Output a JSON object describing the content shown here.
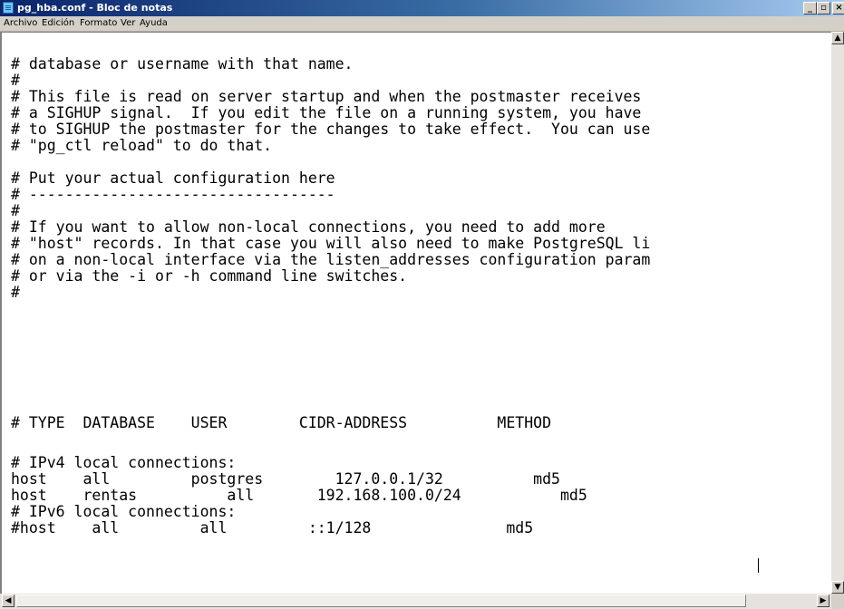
{
  "window": {
    "title": "pg_hba.conf - Bloc de notas",
    "controls": {
      "minimize": "_",
      "maximize": "▫",
      "close": "×"
    }
  },
  "menu": {
    "items": [
      "Archivo",
      "Edición",
      "Formato",
      "Ver",
      "Ayuda"
    ]
  },
  "editor": {
    "lines": [
      "# database or username with that name.",
      "#",
      "# This file is read on server startup and when the postmaster receives",
      "# a SIGHUP signal.  If you edit the file on a running system, you have",
      "# to SIGHUP the postmaster for the changes to take effect.  You can use",
      "# \"pg_ctl reload\" to do that.",
      "",
      "# Put your actual configuration here",
      "# ----------------------------------",
      "#",
      "# If you want to allow non-local connections, you need to add more",
      "# \"host\" records. In that case you will also need to make PostgreSQL li",
      "# on a non-local interface via the listen_addresses configuration param",
      "# or via the -i or -h command line switches.",
      "#",
      "",
      "",
      "",
      "",
      "# TYPE  DATABASE    USER        CIDR-ADDRESS          METHOD",
      "",
      "# IPv4 local connections:",
      "host    all         postgres        127.0.0.1/32          md5",
      "host    rentas          all       192.168.100.0/24           md5",
      "# IPv6 local connections:",
      "#host    all         all         ::1/128               md5"
    ]
  },
  "scrollbars": {
    "up": "▲",
    "down": "▼",
    "left": "◀",
    "right": "▶"
  }
}
